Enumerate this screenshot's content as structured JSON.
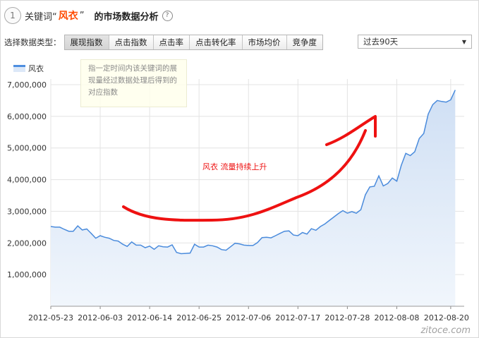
{
  "header": {
    "step_number": "1",
    "prefix": "关键词“",
    "keyword": "风衣",
    "quote_close": "”",
    "suffix": "的市场数据分析",
    "help_icon": "?"
  },
  "data_type": {
    "label": "选择数据类型：",
    "tabs": [
      "展现指数",
      "点击指数",
      "点击率",
      "点击转化率",
      "市场均价",
      "竞争度"
    ],
    "active_tab": 0
  },
  "period_select": {
    "value": "过去90天",
    "caret": "▼"
  },
  "tooltip": {
    "lines": [
      "指一定时间内该关键词的展",
      "现量经过数据处理后得到的",
      "对应指数"
    ]
  },
  "annotation": {
    "text": "风衣  流量持续上升"
  },
  "watermark": "zitoce.com",
  "colors": {
    "line": "#4a8bdc",
    "area_top": "#cfdff4",
    "area_bottom": "#f1f6fc",
    "grid": "#e3e3e3",
    "keyword": "#ff4a00",
    "annotation": "#ee1111"
  },
  "chart_data": {
    "type": "area",
    "title": "",
    "xlabel": "",
    "ylabel": "",
    "legend": {
      "entries": [
        "风衣"
      ],
      "position": "top-left"
    },
    "grid": true,
    "x_ticks": [
      "2012-05-23",
      "2012-06-03",
      "2012-06-14",
      "2012-06-25",
      "2012-07-06",
      "2012-07-17",
      "2012-07-28",
      "2012-08-08",
      "2012-08-20"
    ],
    "y_ticks": [
      "1,000,000",
      "2,000,000",
      "3,000,000",
      "4,000,000",
      "5,000,000",
      "6,000,000",
      "7,000,000"
    ],
    "ylim": [
      0,
      7000000
    ],
    "x_range": [
      "2012-05-23",
      "2012-08-23"
    ],
    "series": [
      {
        "name": "风衣",
        "dates": [
          "2012-05-23",
          "2012-05-24",
          "2012-05-25",
          "2012-05-26",
          "2012-05-27",
          "2012-05-28",
          "2012-05-29",
          "2012-05-30",
          "2012-05-31",
          "2012-06-01",
          "2012-06-02",
          "2012-06-03",
          "2012-06-04",
          "2012-06-05",
          "2012-06-06",
          "2012-06-07",
          "2012-06-08",
          "2012-06-09",
          "2012-06-10",
          "2012-06-11",
          "2012-06-12",
          "2012-06-13",
          "2012-06-14",
          "2012-06-15",
          "2012-06-16",
          "2012-06-17",
          "2012-06-18",
          "2012-06-19",
          "2012-06-20",
          "2012-06-21",
          "2012-06-22",
          "2012-06-23",
          "2012-06-24",
          "2012-06-25",
          "2012-06-26",
          "2012-06-27",
          "2012-06-28",
          "2012-06-29",
          "2012-06-30",
          "2012-07-01",
          "2012-07-02",
          "2012-07-03",
          "2012-07-04",
          "2012-07-05",
          "2012-07-06",
          "2012-07-07",
          "2012-07-08",
          "2012-07-09",
          "2012-07-10",
          "2012-07-11",
          "2012-07-12",
          "2012-07-13",
          "2012-07-14",
          "2012-07-15",
          "2012-07-16",
          "2012-07-17",
          "2012-07-18",
          "2012-07-19",
          "2012-07-20",
          "2012-07-21",
          "2012-07-22",
          "2012-07-23",
          "2012-07-24",
          "2012-07-25",
          "2012-07-26",
          "2012-07-27",
          "2012-07-28",
          "2012-07-29",
          "2012-07-30",
          "2012-07-31",
          "2012-08-01",
          "2012-08-02",
          "2012-08-03",
          "2012-08-04",
          "2012-08-05",
          "2012-08-06",
          "2012-08-07",
          "2012-08-08",
          "2012-08-09",
          "2012-08-10",
          "2012-08-11",
          "2012-08-12",
          "2012-08-13",
          "2012-08-14",
          "2012-08-15",
          "2012-08-16",
          "2012-08-17",
          "2012-08-18",
          "2012-08-19",
          "2012-08-20",
          "2012-08-21"
        ],
        "values": [
          2520000,
          2500000,
          2500000,
          2430000,
          2370000,
          2370000,
          2540000,
          2410000,
          2440000,
          2300000,
          2150000,
          2230000,
          2180000,
          2150000,
          2080000,
          2060000,
          1960000,
          1890000,
          2030000,
          1930000,
          1930000,
          1850000,
          1900000,
          1800000,
          1910000,
          1880000,
          1870000,
          1940000,
          1700000,
          1660000,
          1670000,
          1680000,
          1960000,
          1870000,
          1870000,
          1930000,
          1910000,
          1870000,
          1790000,
          1770000,
          1880000,
          1990000,
          1970000,
          1930000,
          1920000,
          1920000,
          2010000,
          2170000,
          2180000,
          2160000,
          2230000,
          2300000,
          2370000,
          2380000,
          2250000,
          2230000,
          2330000,
          2280000,
          2450000,
          2400000,
          2520000,
          2600000,
          2710000,
          2820000,
          2930000,
          3020000,
          2940000,
          2990000,
          2940000,
          3050000,
          3520000,
          3770000,
          3790000,
          4120000,
          3800000,
          3880000,
          4050000,
          3950000,
          4450000,
          4830000,
          4760000,
          4880000,
          5300000,
          5460000,
          6070000,
          6370000,
          6500000,
          6470000,
          6450000,
          6520000,
          6830000
        ]
      }
    ]
  }
}
